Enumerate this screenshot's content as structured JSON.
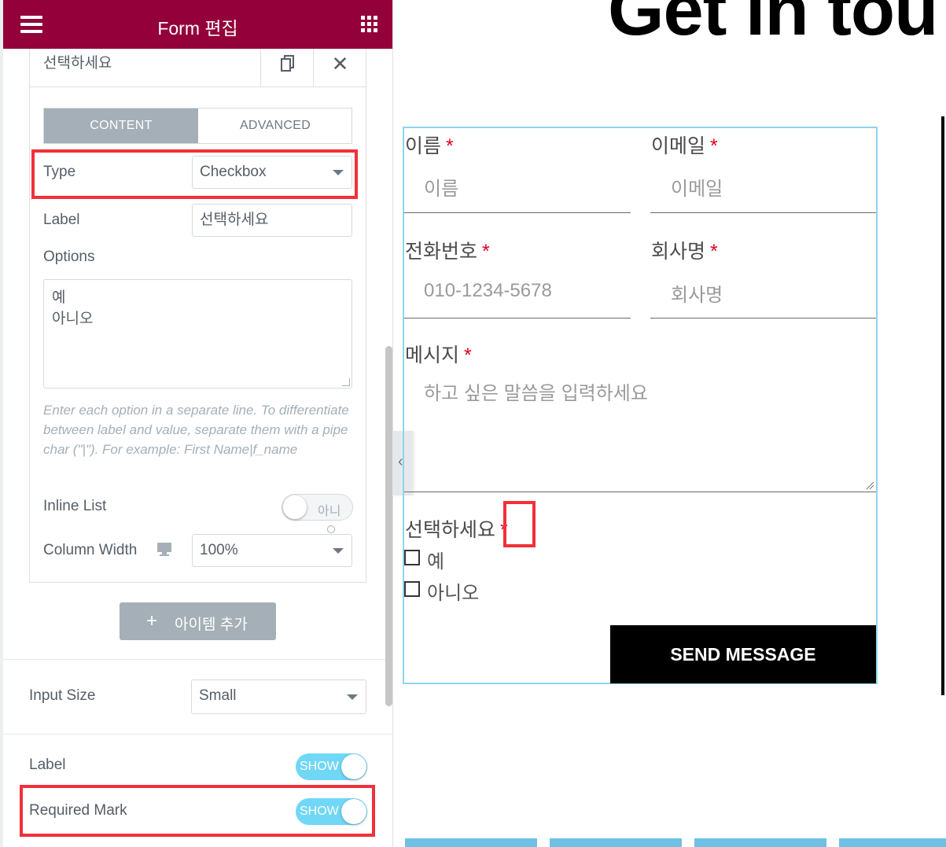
{
  "header": {
    "title": "Form 편집"
  },
  "item": {
    "title": "선택하세요",
    "close_glyph": "✕"
  },
  "tabs": {
    "content": "CONTENT",
    "advanced": "ADVANCED"
  },
  "fields": {
    "type_label": "Type",
    "type_value": "Checkbox",
    "label_label": "Label",
    "label_value": "선택하세요",
    "options_label": "Options",
    "options_lines": [
      "예",
      "아니오"
    ],
    "help_text": "Enter each option in a separate line. To differentiate between label and value, separate them with a pipe char (\"|\"). For example: First Name|f_name",
    "inline_list_label": "Inline List",
    "inline_list_state": "아니",
    "column_width_label": "Column Width",
    "column_width_value": "100%"
  },
  "add_item": {
    "plus": "+",
    "label": "아이템 추가"
  },
  "settings": {
    "input_size_label": "Input Size",
    "input_size_value": "Small",
    "label_toggle_label": "Label",
    "label_toggle_state": "SHOW",
    "required_mark_label": "Required Mark",
    "required_mark_state": "SHOW"
  },
  "preview": {
    "hero": "Get in tou",
    "required_star": "*",
    "name_label": "이름",
    "name_placeholder": "이름",
    "email_label": "이메일",
    "email_placeholder": "이메일",
    "phone_label": "전화번호",
    "phone_placeholder": "010-1234-5678",
    "company_label": "회사명",
    "company_placeholder": "회사명",
    "message_label": "메시지",
    "message_placeholder": "하고 싶은 말씀을 입력하세요",
    "choice_label": "선택하세요",
    "choice_options": [
      "예",
      "아니오"
    ],
    "send_button": "SEND MESSAGE",
    "collapse_glyph": "‹"
  },
  "colors": {
    "header_bg": "#93003a",
    "highlight": "#f2303a",
    "toggle_on": "#71d7f7",
    "form_border": "#8fd4ee",
    "required": "#e3001b",
    "bottom_bar": "#6ec1e4"
  }
}
